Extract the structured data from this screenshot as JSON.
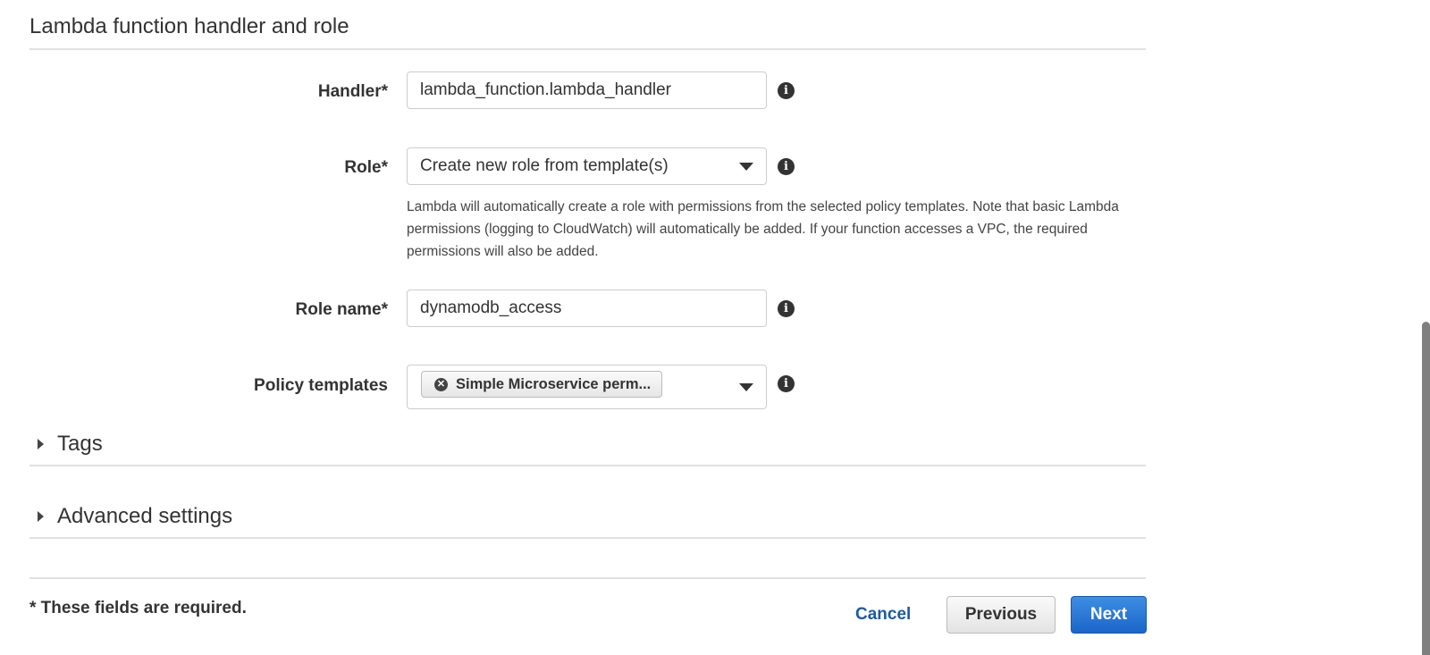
{
  "section": {
    "title": "Lambda function handler and role"
  },
  "form": {
    "handler": {
      "label": "Handler*",
      "value": "lambda_function.lambda_handler"
    },
    "role": {
      "label": "Role*",
      "selected": "Create new role from template(s)",
      "help": "Lambda will automatically create a role with permissions from the selected policy templates. Note that basic Lambda permissions (logging to CloudWatch) will automatically be added. If your function accesses a VPC, the required permissions will also be added."
    },
    "role_name": {
      "label": "Role name*",
      "value": "dynamodb_access"
    },
    "policy_templates": {
      "label": "Policy templates",
      "tokens": [
        "Simple Microservice perm..."
      ]
    }
  },
  "icons": {
    "info": "i",
    "remove": "✕"
  },
  "expanders": {
    "tags": {
      "label": "Tags"
    },
    "advanced": {
      "label": "Advanced settings"
    }
  },
  "footer": {
    "required_note": "* These fields are required.",
    "cancel_label": "Cancel",
    "previous_label": "Previous",
    "next_label": "Next"
  },
  "colors": {
    "primary": "#1b66c9",
    "link": "#1d5aa3"
  }
}
